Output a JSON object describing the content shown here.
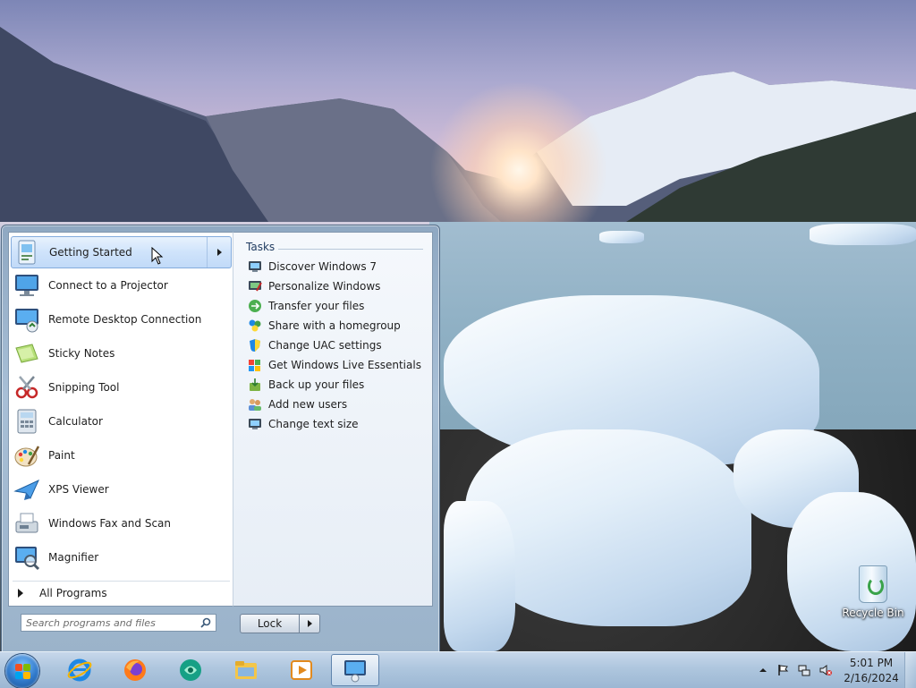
{
  "desktop": {
    "icons": [
      {
        "label": "Recycle Bin",
        "icon": "recycle-bin-icon"
      }
    ]
  },
  "start_menu": {
    "programs": [
      {
        "label": "Getting Started",
        "icon": "getting-started-icon",
        "selected": true,
        "has_jump_list": true
      },
      {
        "label": "Connect to a Projector",
        "icon": "projector-icon"
      },
      {
        "label": "Remote Desktop Connection",
        "icon": "remote-desktop-icon"
      },
      {
        "label": "Sticky Notes",
        "icon": "sticky-notes-icon"
      },
      {
        "label": "Snipping Tool",
        "icon": "snipping-tool-icon"
      },
      {
        "label": "Calculator",
        "icon": "calculator-icon"
      },
      {
        "label": "Paint",
        "icon": "paint-icon"
      },
      {
        "label": "XPS Viewer",
        "icon": "xps-viewer-icon"
      },
      {
        "label": "Windows Fax and Scan",
        "icon": "fax-scan-icon"
      },
      {
        "label": "Magnifier",
        "icon": "magnifier-icon"
      }
    ],
    "all_programs_label": "All Programs",
    "tasks_header": "Tasks",
    "tasks": [
      {
        "label": "Discover Windows 7",
        "icon": "monitor-icon"
      },
      {
        "label": "Personalize Windows",
        "icon": "personalize-icon"
      },
      {
        "label": "Transfer your files",
        "icon": "transfer-icon"
      },
      {
        "label": "Share with a homegroup",
        "icon": "homegroup-icon"
      },
      {
        "label": "Change UAC settings",
        "icon": "uac-shield-icon"
      },
      {
        "label": "Get Windows Live Essentials",
        "icon": "windows-flag-icon"
      },
      {
        "label": "Back up your files",
        "icon": "backup-icon"
      },
      {
        "label": "Add new users",
        "icon": "users-icon"
      },
      {
        "label": "Change text size",
        "icon": "text-size-icon"
      }
    ],
    "search_placeholder": "Search programs and files",
    "lock_label": "Lock"
  },
  "taskbar": {
    "pinned": [
      {
        "name": "internet-explorer",
        "icon": "internet-explorer-icon"
      },
      {
        "name": "firefox",
        "icon": "firefox-icon"
      },
      {
        "name": "app-green",
        "icon": "green-app-icon"
      },
      {
        "name": "windows-explorer",
        "icon": "folder-icon"
      },
      {
        "name": "media-player",
        "icon": "media-player-icon"
      },
      {
        "name": "getting-started",
        "icon": "getting-started-icon",
        "active": true
      }
    ],
    "clock": {
      "time": "5:01 PM",
      "date": "2/16/2024"
    }
  },
  "colors": {
    "selection": "#cfe3fb",
    "taskbar": "#aec6de",
    "menu_frame": "#a8bfd6"
  }
}
